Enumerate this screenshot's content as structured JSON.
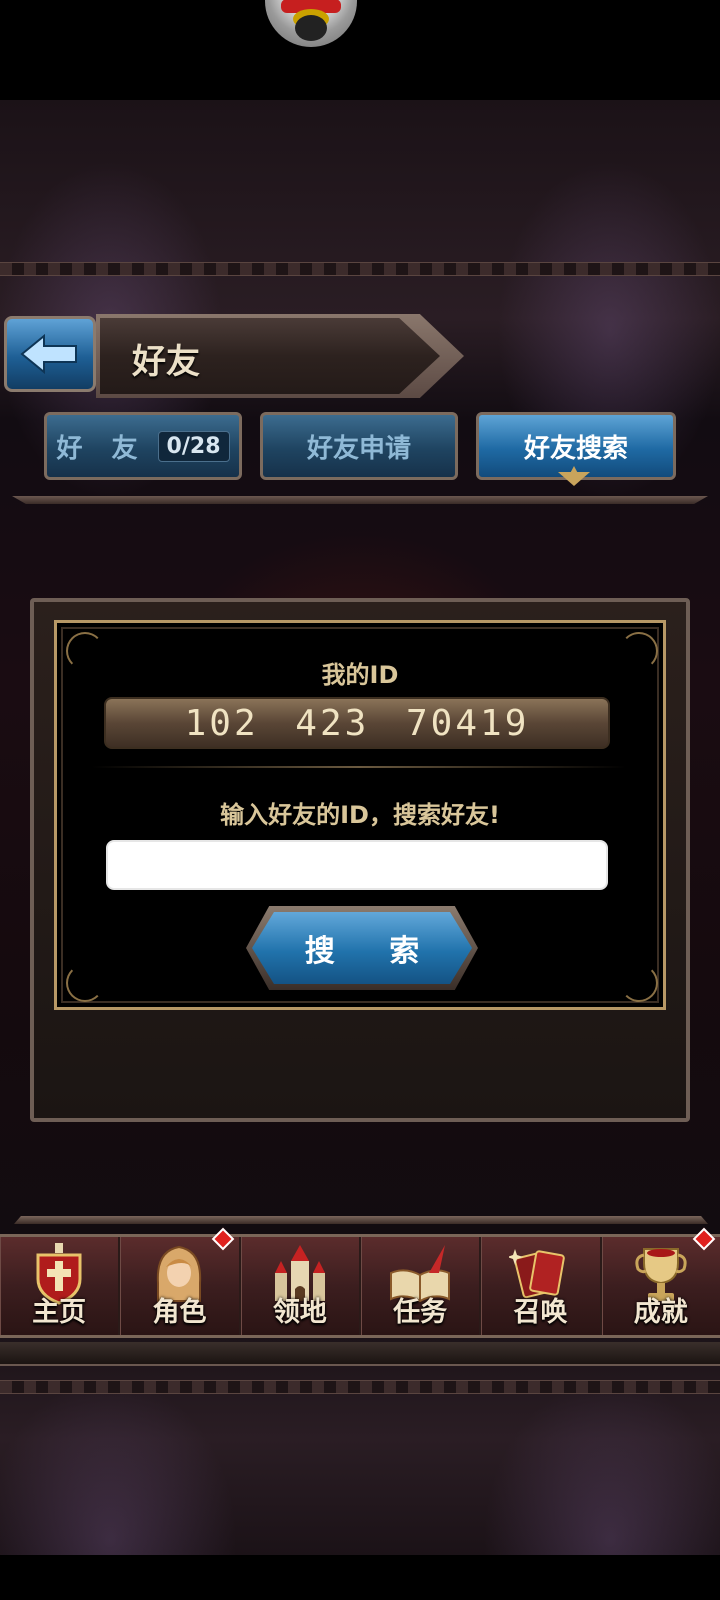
{
  "header": {
    "title": "好友"
  },
  "tabs": [
    {
      "label": "好 友",
      "count": "0/28",
      "active": false
    },
    {
      "label": "好友申请",
      "active": false
    },
    {
      "label": "好友搜索",
      "active": true
    }
  ],
  "panel": {
    "my_id_label": "我的ID",
    "my_id_value": "102 423 70419",
    "search_prompt": "输入好友的ID，搜索好友!",
    "search_input_value": "",
    "search_button_label": "搜 索"
  },
  "nav": {
    "items": [
      {
        "label": "主页",
        "icon": "home-shield-icon",
        "alert": false
      },
      {
        "label": "角色",
        "icon": "character-icon",
        "alert": true
      },
      {
        "label": "领地",
        "icon": "castle-icon",
        "alert": false
      },
      {
        "label": "任务",
        "icon": "quest-book-icon",
        "alert": false
      },
      {
        "label": "召唤",
        "icon": "summon-cards-icon",
        "alert": false
      },
      {
        "label": "成就",
        "icon": "trophy-icon",
        "alert": true
      }
    ]
  },
  "colors": {
    "accent_blue": "#1f6aa4",
    "gold_text": "#d9c69a",
    "alert_red": "#e0201e"
  }
}
